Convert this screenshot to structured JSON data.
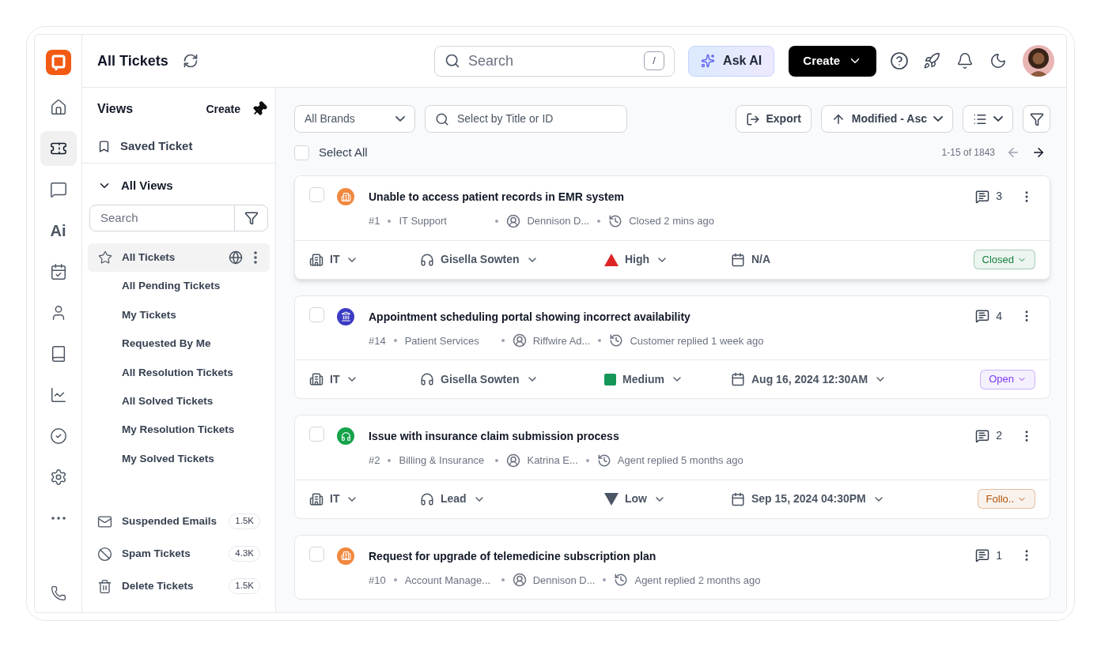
{
  "rail": [
    {
      "kind": "icon",
      "selected": false
    },
    {
      "kind": "icon",
      "selected": true
    },
    {
      "kind": "icon",
      "selected": false
    },
    {
      "kind": "text",
      "label": "Ai",
      "selected": false
    },
    {
      "kind": "icon",
      "selected": false
    },
    {
      "kind": "icon",
      "selected": false
    },
    {
      "kind": "icon",
      "selected": false
    },
    {
      "kind": "icon",
      "selected": false
    },
    {
      "kind": "icon",
      "selected": false
    },
    {
      "kind": "icon",
      "selected": false
    },
    {
      "kind": "icon",
      "selected": false
    }
  ],
  "header": {
    "title": "All Tickets",
    "search_placeholder": "Search",
    "shortcut": "/",
    "ask_ai": "Ask AI",
    "create": "Create"
  },
  "views": {
    "title": "Views",
    "create": "Create",
    "saved": "Saved Ticket",
    "group": {
      "label": "All Views",
      "expanded": true
    },
    "search_placeholder": "Search",
    "items": [
      {
        "label": "All Tickets",
        "selected": true
      },
      {
        "label": "All Pending Tickets",
        "selected": false
      },
      {
        "label": "My Tickets",
        "selected": false
      },
      {
        "label": "Requested By Me",
        "selected": false
      },
      {
        "label": "All Resolution Tickets",
        "selected": false
      },
      {
        "label": "All Solved Tickets",
        "selected": false
      },
      {
        "label": "My Resolution Tickets",
        "selected": false
      },
      {
        "label": "My Solved Tickets",
        "selected": false
      }
    ],
    "folders": [
      {
        "label": "Suspended Emails",
        "count": "1.5K"
      },
      {
        "label": "Spam Tickets",
        "count": "4.3K"
      },
      {
        "label": "Delete Tickets",
        "count": "1.5K"
      }
    ]
  },
  "toolbar": {
    "brands": "All Brands",
    "search_placeholder": "Select by Title or ID",
    "export": "Export",
    "sort": "Modified - Asc"
  },
  "select_all": {
    "label": "Select All",
    "checked": false
  },
  "pagination": {
    "range": "1-15 of 1843",
    "prev_disabled": true
  },
  "tickets": [
    {
      "kind": "building",
      "color": "#f0883e",
      "title": "Unable to access patient records in EMR system",
      "comments": "3",
      "checked": false,
      "number": "#1",
      "team": "IT Support",
      "requester": "Dennison D...",
      "activity": "Closed 2 mins ago",
      "details": {
        "department": "IT",
        "agent": "Gisella Sowten",
        "priority": {
          "kind": "high",
          "label": "High"
        },
        "due": "N/A",
        "due_caret": false,
        "status": {
          "label": "Closed",
          "color": "#15803d"
        }
      }
    },
    {
      "kind": "bank",
      "color": "#3b3bc4",
      "title": "Appointment scheduling portal showing incorrect availability",
      "comments": "4",
      "checked": false,
      "number": "#14",
      "team": "Patient Services",
      "requester": "Riffwire Ad...",
      "activity": "Customer replied 1 week ago",
      "details": {
        "department": "IT",
        "agent": "Gisella Sowten",
        "priority": {
          "kind": "medium",
          "label": "Medium"
        },
        "due": "Aug 16, 2024 12:30AM",
        "due_caret": true,
        "status": {
          "label": "Open",
          "color": "#7c3aed"
        }
      }
    },
    {
      "kind": "headset",
      "color": "#16a34a",
      "title": "Issue with insurance claim submission process",
      "comments": "2",
      "checked": false,
      "number": "#2",
      "team": "Billing & Insurance",
      "requester": "Katrina E...",
      "activity": "Agent replied 5 months ago",
      "details": {
        "department": "IT",
        "agent": "Lead",
        "priority": {
          "kind": "low",
          "label": "Low"
        },
        "due": "Sep 15, 2024 04:30PM",
        "due_caret": true,
        "status": {
          "label": "Follo..",
          "color": "#b45309"
        }
      }
    },
    {
      "kind": "building",
      "color": "#f0883e",
      "title": "Request for upgrade of telemedicine subscription plan",
      "comments": "1",
      "checked": false,
      "number": "#10",
      "team": "Account Manage...",
      "requester": "Dennison D...",
      "activity": "Agent replied 2 months ago"
    }
  ]
}
